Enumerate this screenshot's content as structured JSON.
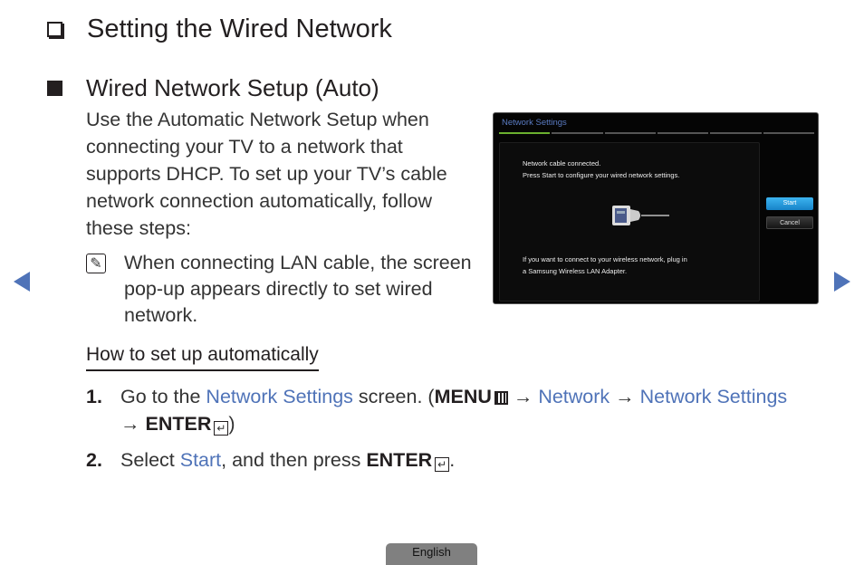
{
  "heading": "Setting the Wired Network",
  "subheading": "Wired Network Setup (Auto)",
  "intro": "Use the Automatic Network Setup when connecting your TV to a network that supports DHCP. To set up your TV’s cable network connection automatically, follow these steps:",
  "note": "When connecting LAN cable, the screen pop-up appears directly to set wired network.",
  "how_to_heading": "How to set up automatically",
  "steps": [
    {
      "num": "1.",
      "p1": "Go to the ",
      "link1": "Network Settings",
      "p2": " screen. (",
      "menu": "MENU",
      "arrow1": " → ",
      "link2": "Network",
      "arrow2": " → ",
      "link3": "Network Settings",
      "arrow3": " → ",
      "enter": "ENTER",
      "p3": ")"
    },
    {
      "num": "2.",
      "p1": "Select ",
      "link1": "Start",
      "p2": ", and then press ",
      "enter": "ENTER",
      "p3": "."
    }
  ],
  "tv_screen": {
    "title": "Network Settings",
    "message_line1": "Network cable connected.",
    "message_line2": "Press Start to configure your wired network settings.",
    "wireless_line1": "If you want to connect to your wireless network, plug in",
    "wireless_line2": "a Samsung Wireless LAN Adapter.",
    "start_button": "Start",
    "cancel_button": "Cancel",
    "progress_steps": 6,
    "active_step": 1
  },
  "language_tab": "English",
  "icons": {
    "prev": "triangle-left-icon",
    "next": "triangle-right-icon",
    "note": "note-pencil-icon",
    "enter": "enter-key-icon",
    "menu": "menu-key-icon"
  },
  "colors": {
    "link_blue": "#4f73b8",
    "tv_title_blue": "#5a7bc2",
    "progress_green": "#6ab02f",
    "start_blue": "#1e90d8"
  }
}
